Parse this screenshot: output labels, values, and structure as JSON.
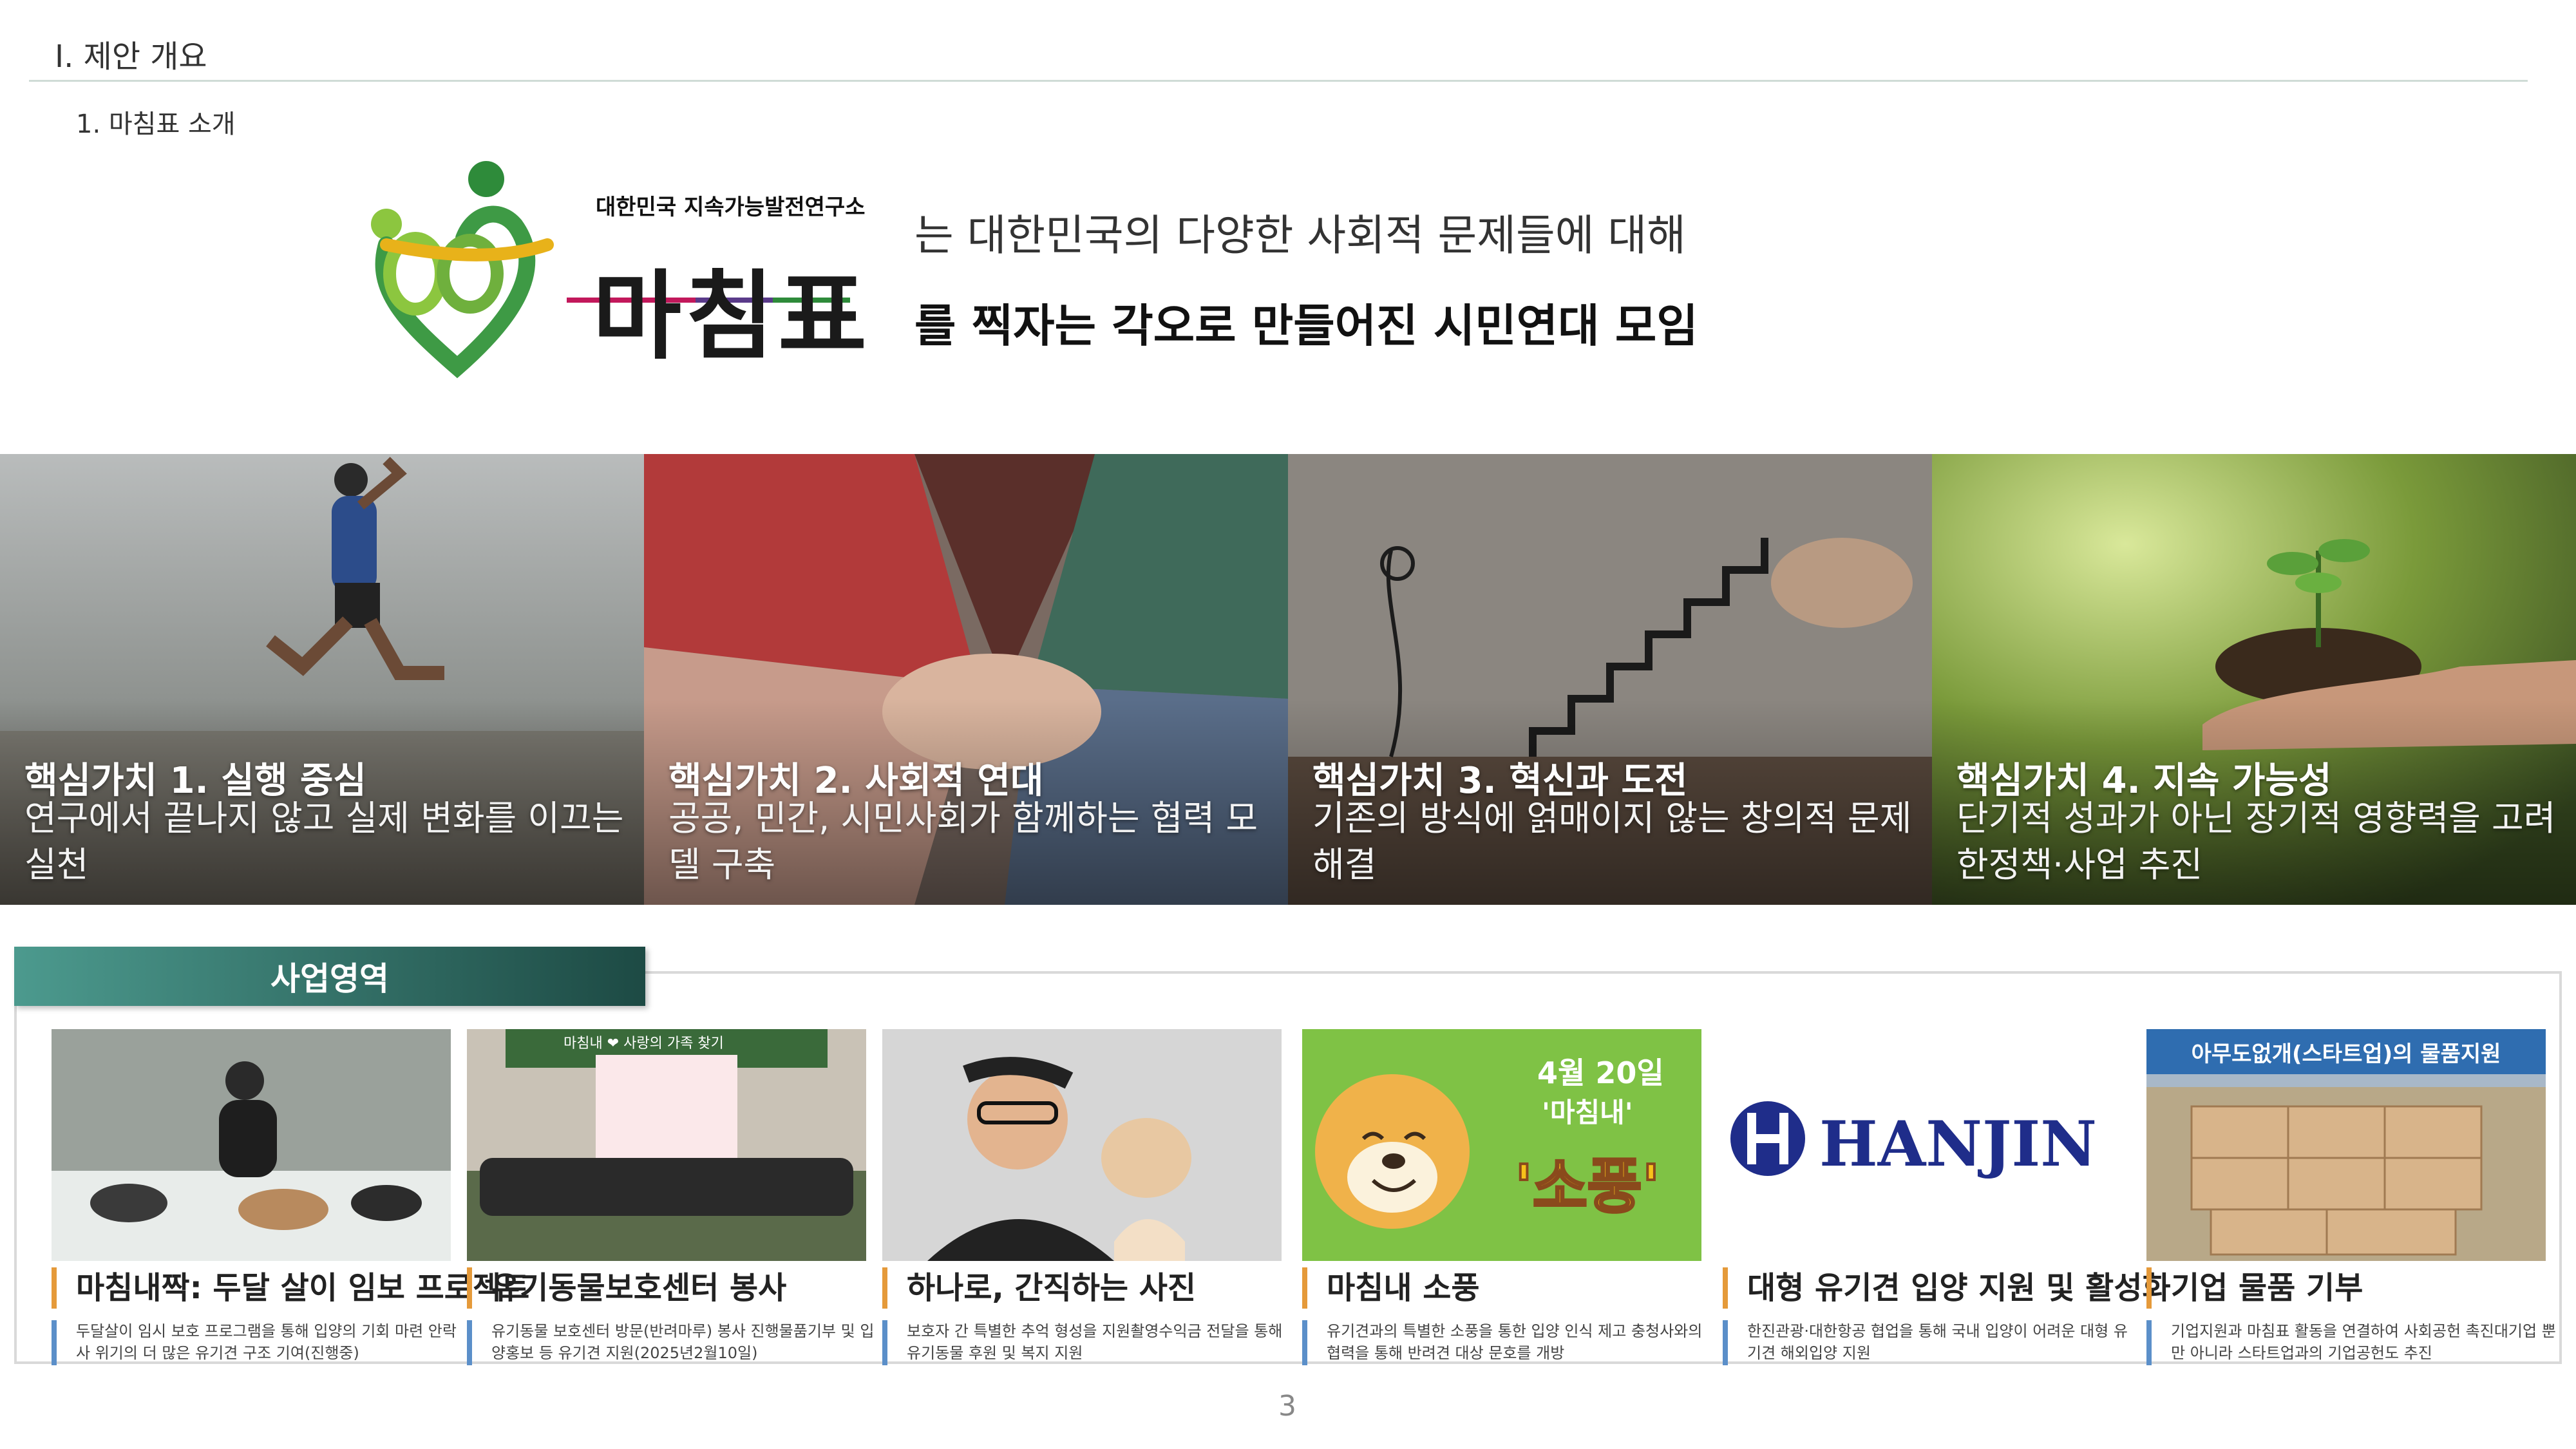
{
  "header": {
    "section_title": "Ⅰ. 제안 개요",
    "sub_title": "1. 마침표 소개"
  },
  "logo": {
    "org_name": "대한민국 지속가능발전연구소",
    "brand": "마침표"
  },
  "tagline": {
    "line1": "는 대한민국의 다양한 사회적 문제들에 대해",
    "line2": "를 찍자는 각오로 만들어진 시민연대 모임"
  },
  "values": [
    {
      "title": "핵심가치 1. 실행 중심",
      "desc": "연구에서 끝나지 않고 실제 변화를 이끄는 실천"
    },
    {
      "title": "핵심가치 2. 사회적 연대",
      "desc": "공공, 민간, 시민사회가 함께하는 협력 모델 구축"
    },
    {
      "title": "핵심가치 3. 혁신과 도전",
      "desc": "기존의 방식에 얽매이지 않는 창의적 문제 해결"
    },
    {
      "title": "핵심가치 4. 지속 가능성",
      "desc": "단기적 성과가 아닌 장기적 영향력을 고려한정책·사업 추진"
    }
  ],
  "business": {
    "tab_label": "사업영역",
    "items": [
      {
        "title": "마침내짝: 두달 살이 임보 프로젝트",
        "desc": "두달살이 임시 보호 프로그램을 통해 입양의 기회 마련 안락사 위기의 더 많은 유기견 구조 기여(진행중)"
      },
      {
        "title": "유기동물보호센터 봉사",
        "desc": "유기동물 보호센터 방문(반려마루) 봉사 진행물품기부 및 입양홍보 등 유기견 지원(2025년2월10일)"
      },
      {
        "title": "하나로, 간직하는 사진",
        "desc": "보호자 간 특별한 추억 형성을 지원촬영수익금 전달을 통해 유기동물 후원 및 복지 지원"
      },
      {
        "title": "마침내 소풍",
        "desc": "유기견과의 특별한 소풍을 통한 입양 인식 제고 충청사와의 협력을 통해 반려견 대상 문호를 개방"
      },
      {
        "title": "대형 유기견 입양 지원 및 활성화",
        "desc": "한진관광·대한항공 협업을 통해 국내 입양이 어려운 대형 유기견 해외입양 지원"
      },
      {
        "title": "기업 물품 기부",
        "desc": "기업지원과 마침표 활동을 연결하여 사회공헌 촉진대기업 뿐만 아니라 스타트업과의 기업공헌도 추진"
      }
    ],
    "photo_text": {
      "banner_title": "마침내 ❤ 사랑의 가족 찾기",
      "picnic_date": "4월 20일",
      "picnic_name": "'마침내'",
      "picnic_big": "'소풍'",
      "hanjin": "HANJIN",
      "donation_caption": "아무도없개(스타트업)의 물품지원"
    }
  },
  "page": {
    "number": "3"
  },
  "colors": {
    "accent_green": "#4c9a8e",
    "bar_orange": "#e59a3a",
    "bar_blue": "#5b8fc9",
    "logo_green": "#3e9a45",
    "logo_yellow": "#e8b21a"
  }
}
